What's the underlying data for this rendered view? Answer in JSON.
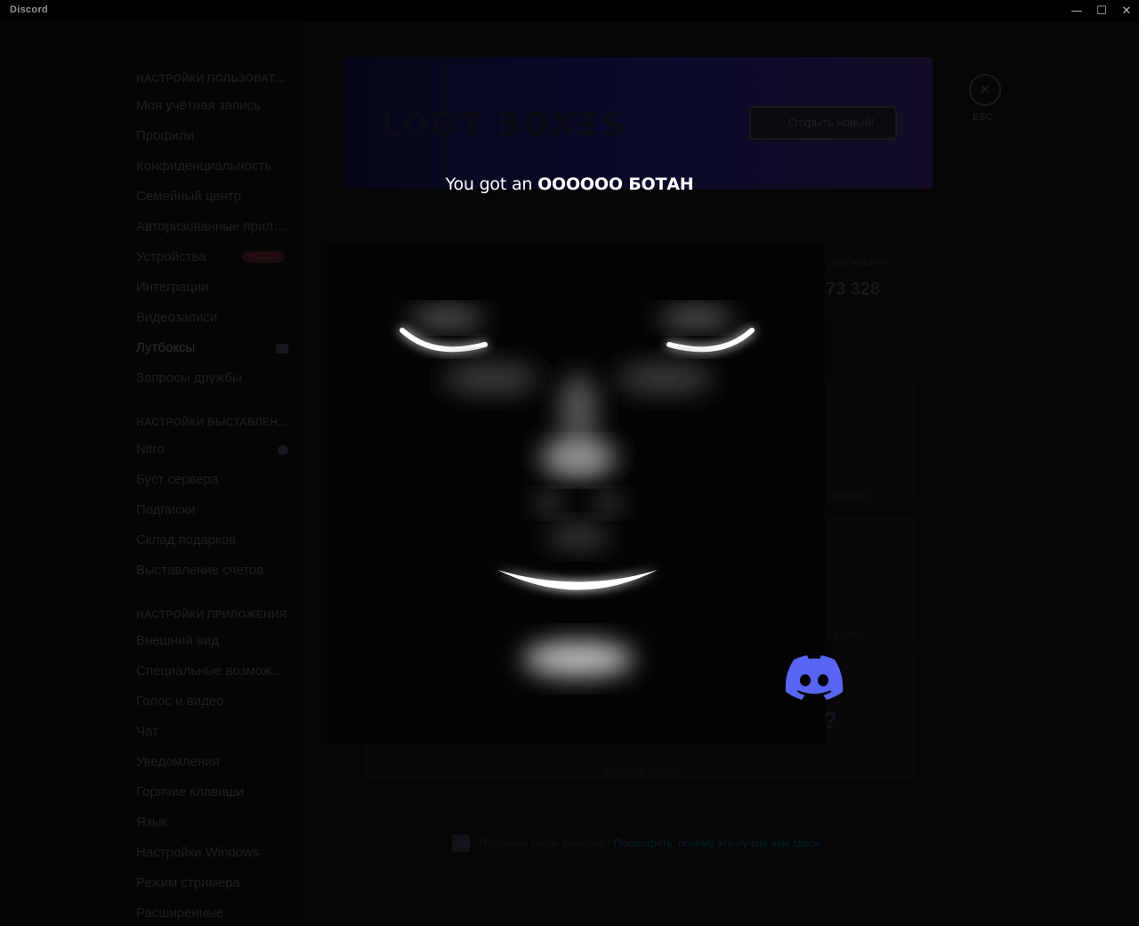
{
  "window": {
    "title": "Discord",
    "min_icon": "minimize-icon",
    "max_icon": "maximize-icon",
    "close_icon": "close-icon"
  },
  "sidebar": {
    "user_header": "НАСТРОЙКИ ПОЛЬЗОВАТЕЛЯ",
    "user_items": [
      "Моя учётная запись",
      "Профили",
      "Конфиденциальность",
      "Семейный центр",
      "Авторизованные приложения",
      "Устройства",
      "Интеграции",
      "Видеозаписи",
      "Лутбоксы",
      "Запросы дружбы"
    ],
    "new_badge": "НОВОЕ",
    "billing_header": "НАСТРОЙКИ ВЫСТАВЛЕНИЯ СЧЕТОВ",
    "billing_items": [
      "Nitro",
      "Буст сервера",
      "Подписки",
      "Склад подарков",
      "Выставление счетов"
    ],
    "app_header": "НАСТРОЙКИ ПРИЛОЖЕНИЯ",
    "app_items": [
      "Внешний вид",
      "Специальные возможности",
      "Голос и видео",
      "Чат",
      "Уведомления",
      "Горячие клавиши",
      "Язык",
      "Настройки Windows",
      "Режим стримера",
      "Расширенные"
    ]
  },
  "content": {
    "banner_title": "LOOT BOXES",
    "banner_button": "Открыть новый!",
    "stat_label": "...ные нажатия",
    "stat_value": "73 328",
    "item_labels": [
      "...обнимка",
      "...в силы",
      "OOOOOO БАНАН"
    ],
    "unknown_mark": "?",
    "footer_text": "Получили такую реакцию? ",
    "footer_link": "Посмотреть, почему это лучше чем здесь"
  },
  "close": {
    "icon": "close-icon",
    "label": "ESC"
  },
  "reward": {
    "prefix": "You got an ",
    "item_name": "OOOOOO БОТАН",
    "image": "glowing-face-image",
    "logo": "discord-logo-icon",
    "logo_color": "#5865f2"
  }
}
